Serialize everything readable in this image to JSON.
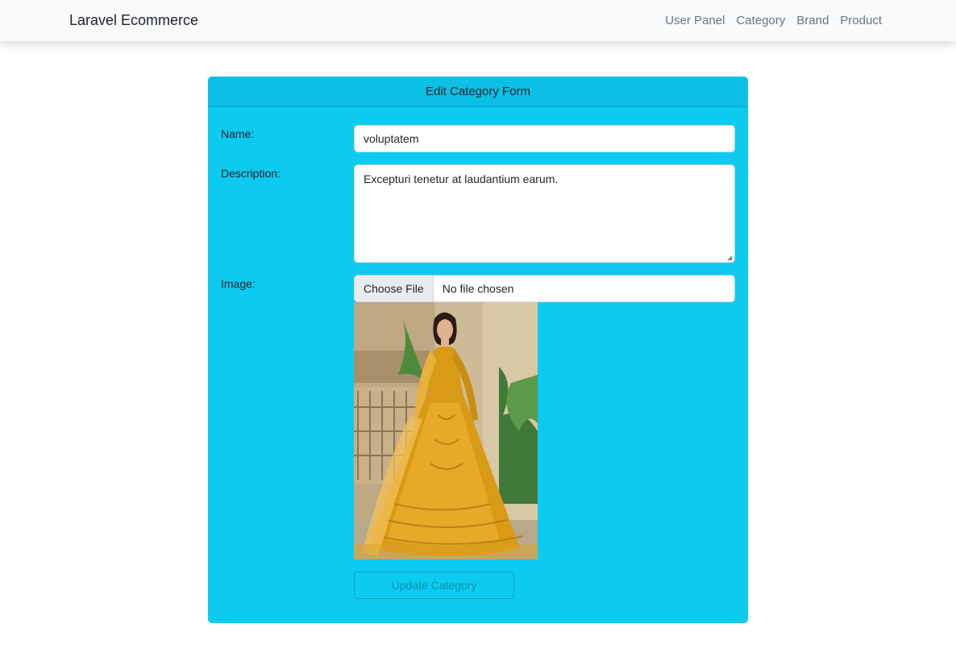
{
  "navbar": {
    "brand": "Laravel Ecommerce",
    "links": [
      "User Panel",
      "Category",
      "Brand",
      "Product"
    ]
  },
  "form": {
    "title": "Edit Category Form",
    "name_label": "Name:",
    "name_value": "voluptatem",
    "description_label": "Description:",
    "description_value": "Excepturi tenetur at laudantium earum.",
    "image_label": "Image:",
    "file_button": "Choose File",
    "file_status": "No file chosen",
    "submit_label": "Update Category"
  },
  "colors": {
    "card_bg": "#0dcaf0",
    "navbar_bg": "#f8f9fa",
    "dress": "#d99a16"
  }
}
